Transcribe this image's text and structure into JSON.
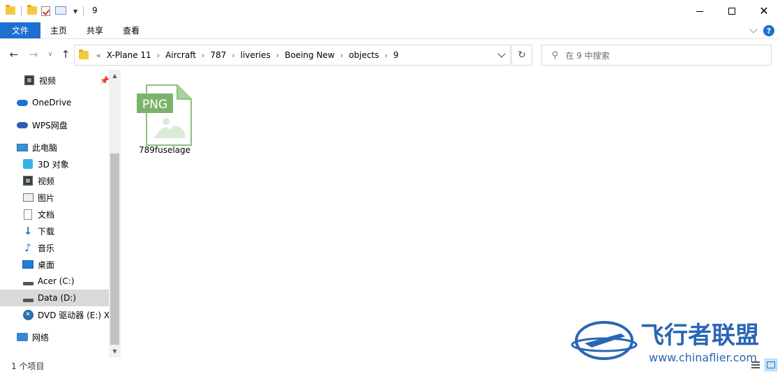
{
  "window": {
    "title": "9"
  },
  "ribbon": {
    "tabs": [
      "文件",
      "主页",
      "共享",
      "查看"
    ],
    "help": "?"
  },
  "address": {
    "breadcrumbs": [
      "X-Plane 11",
      "Aircraft",
      "787",
      "liveries",
      "Boeing New",
      "objects",
      "9"
    ],
    "overflow": "«"
  },
  "search": {
    "placeholder": "在 9 中搜索"
  },
  "sidebar": {
    "items": [
      {
        "label": "视频",
        "icon": "video-icon",
        "pinned": true
      },
      {
        "label": "OneDrive",
        "icon": "onedrive-icon"
      },
      {
        "label": "WPS网盘",
        "icon": "wps-cloud-icon"
      },
      {
        "label": "此电脑",
        "icon": "this-pc-icon"
      },
      {
        "label": "3D 对象",
        "icon": "3d-objects-icon"
      },
      {
        "label": "视频",
        "icon": "video-icon"
      },
      {
        "label": "图片",
        "icon": "pictures-icon"
      },
      {
        "label": "文档",
        "icon": "documents-icon"
      },
      {
        "label": "下载",
        "icon": "downloads-icon"
      },
      {
        "label": "音乐",
        "icon": "music-icon"
      },
      {
        "label": "桌面",
        "icon": "desktop-icon"
      },
      {
        "label": "Acer (C:)",
        "icon": "drive-icon"
      },
      {
        "label": "Data (D:)",
        "icon": "drive-icon",
        "selected": true
      },
      {
        "label": "DVD 驱动器 (E:) XI",
        "icon": "dvd-icon"
      },
      {
        "label": "网络",
        "icon": "network-icon"
      }
    ]
  },
  "files": [
    {
      "name": "789fuselage",
      "type_badge": "PNG"
    }
  ],
  "status": {
    "count": "1 个项目"
  },
  "watermark": {
    "title": "飞行者联盟",
    "url": "www.chinaflier.com"
  },
  "colors": {
    "accent": "#1e6fd0",
    "png_green": "#7bb36a",
    "selected": "#d9d9d9"
  }
}
